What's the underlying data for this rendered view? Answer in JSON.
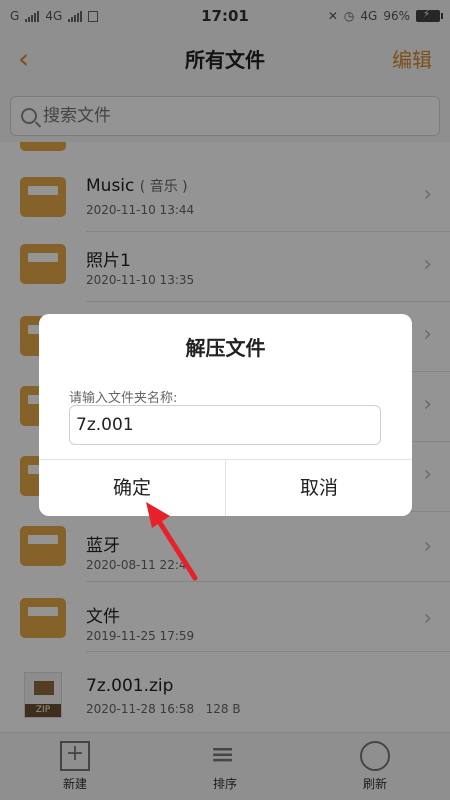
{
  "status": {
    "carrier": "G",
    "network": "4G",
    "time": "17:01",
    "network_right": "4G",
    "battery": "96%"
  },
  "nav": {
    "title": "所有文件",
    "edit": "编辑"
  },
  "search": {
    "placeholder": "搜索文件"
  },
  "files": [
    {
      "name": "Music",
      "note": "( 音乐 )",
      "date": "2020-11-10 13:44",
      "type": "folder"
    },
    {
      "name": "照片1",
      "date": "2020-11-10 13:35",
      "type": "folder"
    },
    {
      "name": "",
      "date": "",
      "type": "folder"
    },
    {
      "name": "",
      "date": "",
      "type": "folder"
    },
    {
      "name": "",
      "date": "",
      "type": "folder"
    },
    {
      "name": "蓝牙",
      "date": "2020-08-11 22:4",
      "type": "folder"
    },
    {
      "name": "文件",
      "date": "2019-11-25 17:59",
      "type": "folder"
    },
    {
      "name": "7z.001.zip",
      "date": "2020-11-28 16:58",
      "size": "128 B",
      "type": "zip",
      "badge": "ZIP"
    }
  ],
  "toolbar": {
    "new": "新建",
    "sort": "排序",
    "refresh": "刷新"
  },
  "dialog": {
    "title": "解压文件",
    "label": "请输入文件夹名称:",
    "value": "7z.001",
    "ok": "确定",
    "cancel": "取消"
  },
  "colors": {
    "accent": "#d98a2b",
    "folder": "#e7a94a",
    "arrow": "#e8202a"
  }
}
